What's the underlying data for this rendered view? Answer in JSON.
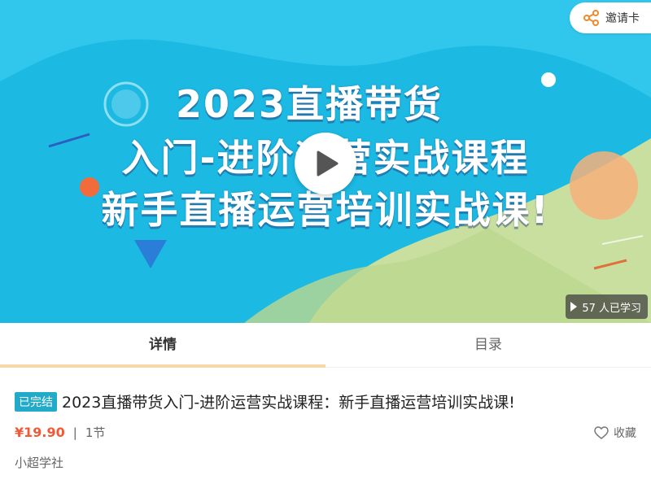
{
  "banner": {
    "line1": "2023直播带货",
    "line2": "入门-进阶运营实战课程",
    "line3": "新手直播运营培训实战课!",
    "colors": {
      "sky": "#1cb9e3",
      "wave": "#2fc8ee",
      "grass": "#c8dfa0"
    }
  },
  "share": {
    "label": "邀请卡",
    "icon": "share-icon",
    "icon_color": "#f08a2c"
  },
  "play": {
    "icon": "play-icon"
  },
  "learners": {
    "text": "57 人已学习"
  },
  "tabs": [
    {
      "label": "详情",
      "active": true
    },
    {
      "label": "目录",
      "active": false
    }
  ],
  "course": {
    "status_badge": "已完结",
    "title": "2023直播带货入门-进阶运营实战课程：新手直播运营培训实战课!",
    "price": "¥19.90",
    "separator": "|",
    "lessons": "1节",
    "favorite_label": "收藏",
    "author": "小超学社"
  }
}
